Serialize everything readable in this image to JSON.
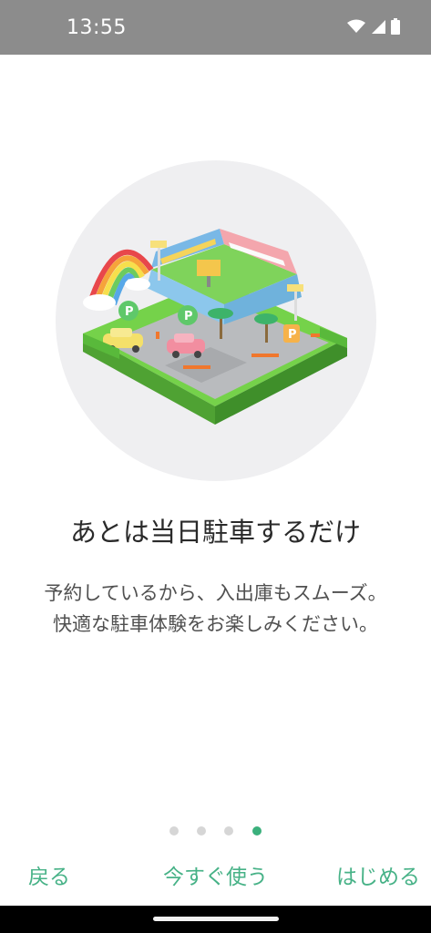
{
  "status_bar": {
    "time": "13:55",
    "icons": [
      "wifi-icon",
      "cellular-signal-icon",
      "battery-icon"
    ]
  },
  "onboarding": {
    "illustration": "parking-stadium-illustration",
    "title": "あとは当日駐車するだけ",
    "description_line1": "予約しているから、入出庫もスムーズ。",
    "description_line2": "快適な駐車体験をお楽しみください。",
    "page_indicator": {
      "total": 4,
      "current": 4
    }
  },
  "nav": {
    "back_label": "戻る",
    "use_now_label": "今すぐ使う",
    "start_label": "はじめる"
  },
  "colors": {
    "accent": "#47b287",
    "status_bar": "#8c8c8c",
    "dot_inactive": "#d6d6d6",
    "dot_active": "#3bb07c"
  }
}
